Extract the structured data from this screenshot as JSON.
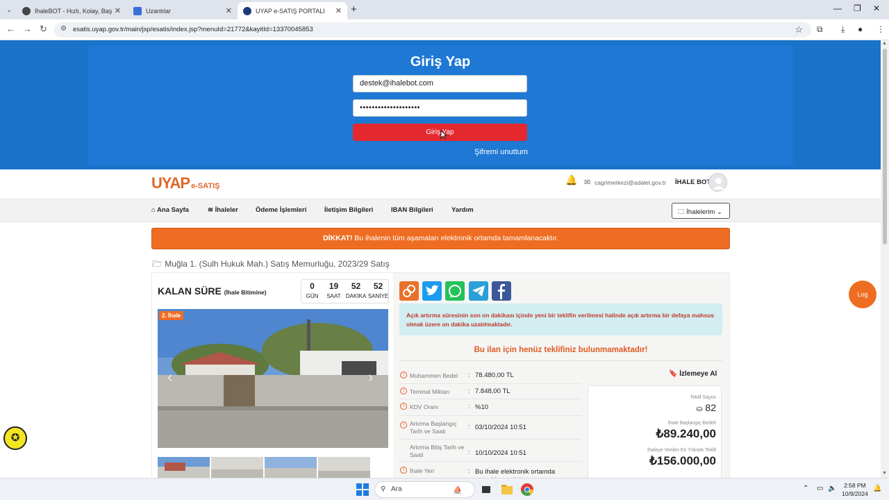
{
  "browser": {
    "tabs": [
      {
        "title": "İhaleBOT - Hızlı, Kolay, Başarılı!",
        "active": false
      },
      {
        "title": "Uzantılar",
        "active": false
      },
      {
        "title": "UYAP e-SATIŞ PORTALI",
        "active": true
      }
    ],
    "url": "esatis.uyap.gov.tr/main/jsp/esatis/index.jsp?menuId=21772&kayitId=13370045853"
  },
  "login": {
    "title": "Giriş Yap",
    "email": "destek@ihalebot.com",
    "password": "••••••••••••••••••••",
    "button": "Giriş Yap",
    "forgot": "Şifremi unuttum"
  },
  "header": {
    "logo_main": "UYAP",
    "logo_sub": "e-SATIŞ",
    "email": "cagrimerkezi@adalet.gov.tr",
    "user": "İHALE BOT"
  },
  "nav": {
    "items": [
      "Ana Sayfa",
      "İhaleler",
      "Ödeme İşlemleri",
      "İletişim Bilgileri",
      "IBAN Bilgileri",
      "Yardım"
    ],
    "my_auctions": "İhalelerim"
  },
  "warning": {
    "bold": "DİKKAT!",
    "text": " Bu ihalenin tüm aşamaları elektronik ortamda tamamlanacaktır."
  },
  "breadcrumb": "Muğla 1. (Sulh Hukuk Mah.) Satış Memurluğu, 2023/29 Satış",
  "remaining": {
    "title": "KALAN SÜRE",
    "subtitle": "(İhale Bitimine)",
    "cells": [
      {
        "value": "0",
        "label": "GÜN"
      },
      {
        "value": "19",
        "label": "SAAT"
      },
      {
        "value": "52",
        "label": "DAKİKA"
      },
      {
        "value": "52",
        "label": "SANİYE"
      }
    ]
  },
  "photo_tag": "2. İhale",
  "info_text": "Açık artırma süresinin son on dakikası içinde yeni bir teklifin verilmesi halinde açık artırma bir defaya mahsus olmak üzere on dakika uzatılmaktadır.",
  "no_offer": "Bu ilan için henüz teklifiniz bulunmamaktadır!",
  "watch": "İzlemeye Al",
  "details": [
    {
      "label": "Muhammen Bedel",
      "value": "78.480,00 TL"
    },
    {
      "label": "Teminat Miktarı",
      "value": "7.848,00 TL"
    },
    {
      "label": "KDV Oranı",
      "value": "%10"
    },
    {
      "label": "Artırma Başlangıç Tarih ve Saati",
      "value": "03/10/2024 10:51"
    },
    {
      "label": "Artırma Bitiş Tarih ve Saati",
      "value": "10/10/2024 10:51"
    },
    {
      "label": "İhale Yeri",
      "value": "Bu ihale elektronik ortamda gerçekleşecektir."
    }
  ],
  "stats": {
    "offer_count_label": "Teklif Sayısı",
    "offer_count": "82",
    "start_price_label": "İhale Başlangıç Bedeli",
    "start_price": "₺89.240,00",
    "highest_label": "İhaleye Verilen En Yüksek Teklif",
    "highest": "₺156.000,00"
  },
  "log_button": "Log",
  "taskbar": {
    "search": "Ara",
    "time": "2:58 PM",
    "date": "10/9/2024"
  }
}
